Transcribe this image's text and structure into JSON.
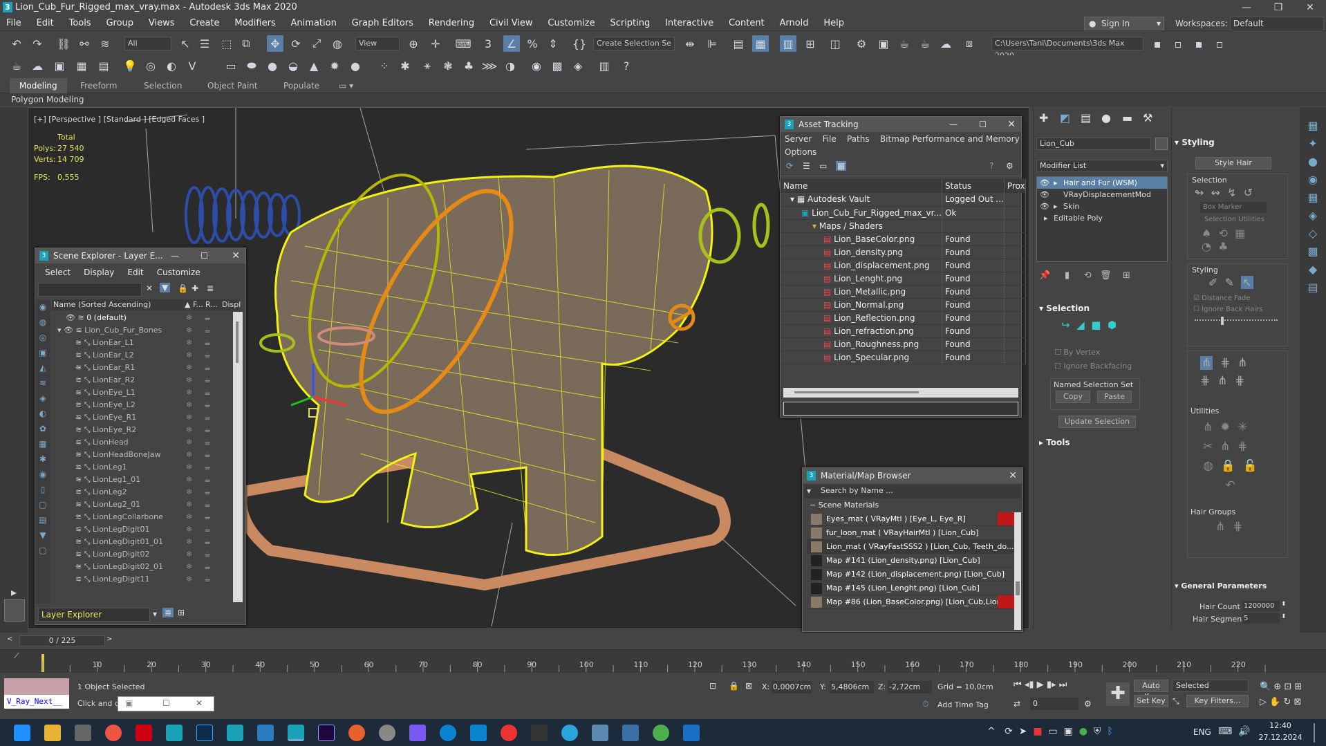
{
  "titlebar": {
    "title": "Lion_Cub_Fur_Rigged_max_vray.max - Autodesk 3ds Max 2020"
  },
  "menu": [
    "File",
    "Edit",
    "Tools",
    "Group",
    "Views",
    "Create",
    "Modifiers",
    "Animation",
    "Graph Editors",
    "Rendering",
    "Civil View",
    "Customize",
    "Scripting",
    "Interactive",
    "Content",
    "Arnold",
    "Help"
  ],
  "signin": "Sign In",
  "workspaces_label": "Workspaces:",
  "workspace": "Default",
  "toolbar": {
    "filter": "All",
    "view": "View",
    "selection_set": "Create Selection Se",
    "path": "C:\\Users\\Tani\\Documents\\3ds Max 2020"
  },
  "ribbon": {
    "tabs": [
      "Modeling",
      "Freeform",
      "Selection",
      "Object Paint",
      "Populate"
    ],
    "sub": "Polygon Modeling"
  },
  "viewport": {
    "label": "[+] [Perspective ] [Standard ] [Edged Faces ]",
    "total": "Total",
    "polys_label": "Polys:",
    "polys": "27 540",
    "verts_label": "Verts:",
    "verts": "14 709",
    "fps_label": "FPS:",
    "fps": "0,555"
  },
  "asset_tracking": {
    "title": "Asset Tracking",
    "menu": [
      "Server",
      "File",
      "Paths",
      "Bitmap Performance and Memory"
    ],
    "menu2": "Options",
    "columns": [
      "Name",
      "Status",
      "Prox"
    ],
    "rows": [
      {
        "name": "Autodesk Vault",
        "status": "Logged Out ..."
      },
      {
        "name": "Lion_Cub_Fur_Rigged_max_vr...",
        "status": "Ok"
      },
      {
        "name": "Maps / Shaders",
        "status": ""
      },
      {
        "name": "Lion_BaseColor.png",
        "status": "Found"
      },
      {
        "name": "Lion_density.png",
        "status": "Found"
      },
      {
        "name": "Lion_displacement.png",
        "status": "Found"
      },
      {
        "name": "Lion_Lenght.png",
        "status": "Found"
      },
      {
        "name": "Lion_Metallic.png",
        "status": "Found"
      },
      {
        "name": "Lion_Normal.png",
        "status": "Found"
      },
      {
        "name": "Lion_Reflection.png",
        "status": "Found"
      },
      {
        "name": "Lion_refraction.png",
        "status": "Found"
      },
      {
        "name": "Lion_Roughness.png",
        "status": "Found"
      },
      {
        "name": "Lion_Specular.png",
        "status": "Found"
      }
    ]
  },
  "scene_explorer": {
    "title": "Scene Explorer - Layer E...",
    "menu": [
      "Select",
      "Display",
      "Edit",
      "Customize"
    ],
    "col_name": "Name (Sorted Ascending)",
    "col_f": "▲ F...",
    "col_r": "R...",
    "col_d": "Displ",
    "rows": [
      "0 (default)",
      "Lion_Cub_Fur_Bones",
      "LionEar_L1",
      "LionEar_L2",
      "LionEar_R1",
      "LionEar_R2",
      "LionEye_L1",
      "LionEye_L2",
      "LionEye_R1",
      "LionEye_R2",
      "LionHead",
      "LionHeadBoneJaw",
      "LionLeg1",
      "LionLeg1_01",
      "LionLeg2",
      "LionLeg2_01",
      "LionLegCollarbone",
      "LionLegDigit01",
      "LionLegDigit01_01",
      "LionLegDigit02",
      "LionLegDigit02_01",
      "LionLegDigit11"
    ],
    "footer": "Layer Explorer"
  },
  "material_browser": {
    "title": "Material/Map Browser",
    "search": "Search by Name ...",
    "group": "Scene Materials",
    "rows": [
      "Eyes_mat  ( VRayMtl ) [Eye_L, Eye_R]",
      "fur_loon_mat  ( VRayHairMtl ) [Lion_Cub]",
      "Lion_mat  ( VRayFastSSS2 ) [Lion_Cub, Teeth_do...",
      "Map #141 (Lion_density.png) [Lion_Cub]",
      "Map #142 (Lion_displacement.png) [Lion_Cub]",
      "Map #145 (Lion_Lenght.png) [Lion_Cub]",
      "Map #86 (Lion_BaseColor.png) [Lion_Cub,Lion_..."
    ]
  },
  "command_panel": {
    "object_name": "Lion_Cub",
    "modifier_list": "Modifier List",
    "stack": [
      "Hair and Fur (WSM)",
      "VRayDisplacementMod",
      "Skin",
      "Editable Poly"
    ],
    "selection": "Selection",
    "by_vertex": "By Vertex",
    "ignore_backfacing": "Ignore Backfacing",
    "named_sel_set": "Named Selection Set",
    "copy": "Copy",
    "paste": "Paste",
    "update_selection": "Update Selection",
    "tools": "Tools"
  },
  "styling_panel": {
    "header": "Styling",
    "style_hair": "Style Hair",
    "selection": "Selection",
    "box_marker": "Box Marker",
    "selection_utilities": "Selection Utilities",
    "styling": "Styling",
    "distance_fade": "Distance Fade",
    "ignore_back_hairs": "Ignore Back Hairs",
    "utilities": "Utilities",
    "hair_groups": "Hair Groups",
    "general_params": "General Parameters",
    "hair_count_label": "Hair Count",
    "hair_count": "1200000",
    "hair_segments_label": "Hair Segments",
    "hair_segments": "5"
  },
  "timeline": {
    "frame": "0 / 225",
    "ticks": [
      "10",
      "20",
      "30",
      "40",
      "50",
      "60",
      "70",
      "80",
      "90",
      "100",
      "110",
      "120",
      "130",
      "140",
      "150",
      "160",
      "170",
      "180",
      "190",
      "200",
      "210",
      "220"
    ]
  },
  "status": {
    "script_label": "V_Ray_Next__",
    "objects": "1 Object Selected",
    "prompt": "Click and dra",
    "x_label": "X:",
    "x": "0,0007cm",
    "y_label": "Y:",
    "y": "5,4806cm",
    "z_label": "Z:",
    "z": "-2,72cm",
    "grid": "Grid = 10,0cm",
    "add_time_tag": "Add Time Tag",
    "auto_key": "Auto Key",
    "set_key": "Set Key",
    "selected": "Selected",
    "key_filters": "Key Filters...",
    "frame_field": "0"
  },
  "taskbar": {
    "lang": "ENG",
    "time": "12:40",
    "date": "27.12.2024"
  }
}
